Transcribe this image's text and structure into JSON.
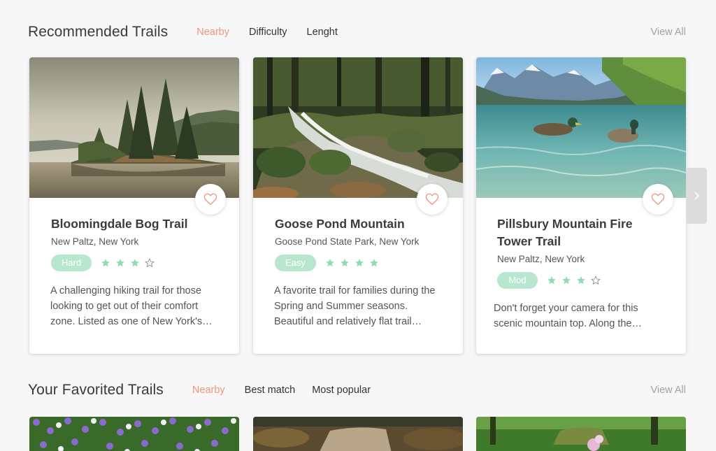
{
  "recommended": {
    "title": "Recommended Trails",
    "tabs": [
      {
        "label": "Nearby",
        "active": true
      },
      {
        "label": "Difficulty",
        "active": false
      },
      {
        "label": "Lenght",
        "active": false
      }
    ],
    "view_all": "View All",
    "cards": [
      {
        "title": "Bloomingdale Bog Trail",
        "location": "New Paltz, New York",
        "difficulty": "Hard",
        "rating": 3,
        "max_rating": 4,
        "description": "A challenging hiking trail for those looking to get out of their comfort zone. Listed as one of New York's…",
        "favorite_icon": "heart-outline-icon"
      },
      {
        "title": "Goose Pond Mountain",
        "location": "Goose Pond State Park, New York",
        "difficulty": "Easy",
        "rating": 4,
        "max_rating": 4,
        "description": "A favorite trail for families during the Spring and Summer seasons. Beautiful and relatively flat trail…",
        "favorite_icon": "heart-outline-icon"
      },
      {
        "title": "Pillsbury Mountain Fire Tower Trail",
        "location": "New Paltz, New York",
        "difficulty": "Mod",
        "rating": 3,
        "max_rating": 4,
        "description": "Don't forget your camera for this scenic mountain top. Along the…",
        "favorite_icon": "heart-outline-icon"
      }
    ]
  },
  "favorited": {
    "title": "Your Favorited Trails",
    "tabs": [
      {
        "label": "Nearby",
        "active": true
      },
      {
        "label": "Best match",
        "active": false
      },
      {
        "label": "Most popular",
        "active": false
      }
    ],
    "view_all": "View All"
  },
  "next_icon": "chevron-right-icon",
  "colors": {
    "accent": "#f0957a",
    "badge": "#b8e6cf",
    "star": "#8fdcb2",
    "muted": "#9ea3a8"
  }
}
